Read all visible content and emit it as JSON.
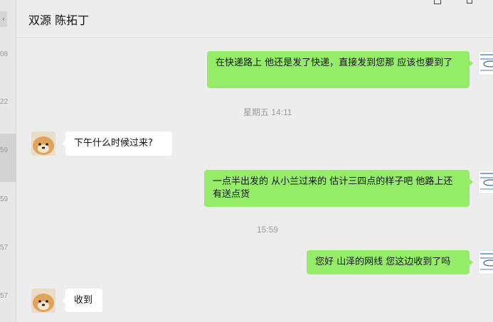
{
  "chat_list": {
    "times": [
      "08",
      "22",
      "59",
      "59",
      "57",
      "57"
    ]
  },
  "header": {
    "title": "双源 陈拓丁"
  },
  "messages": [
    {
      "kind": "out",
      "text": "在快递路上 他还是发了快递，直接发到您那 应该也要到了"
    },
    {
      "kind": "time",
      "text": "星期五 14:11"
    },
    {
      "kind": "in",
      "text": "下午什么时候过来?"
    },
    {
      "kind": "out",
      "text": "一点半出发的 从小兰过来的 估计三四点的样子吧 他路上还有送点货"
    },
    {
      "kind": "time",
      "text": "15:59"
    },
    {
      "kind": "out",
      "text": "您好 山泽的网线 您这边收到了吗"
    },
    {
      "kind": "in",
      "text": "收到"
    }
  ],
  "avatars": {
    "contact": "dog-avatar-icon",
    "self": "product-thumbnail-avatar"
  },
  "colors": {
    "outgoing_bubble": "#95ec69",
    "incoming_bubble": "#ffffff",
    "background": "#ededed"
  }
}
